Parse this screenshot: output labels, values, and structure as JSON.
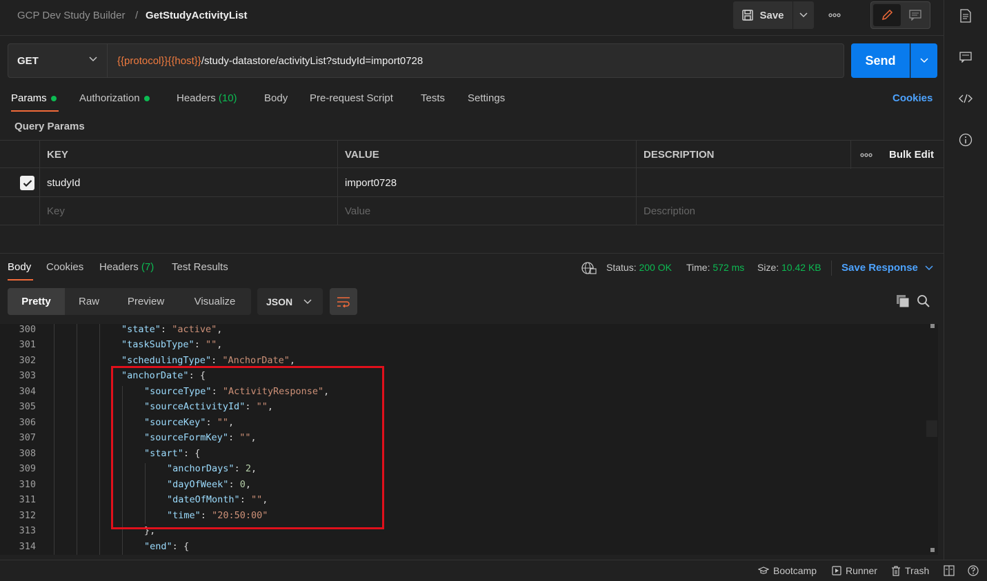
{
  "header": {
    "workspace": "GCP Dev Study Builder",
    "separator": "/",
    "request_name": "GetStudyActivityList",
    "save_label": "Save"
  },
  "request": {
    "method": "GET",
    "url_var1": "{{protocol}}",
    "url_var2": "{{host}}",
    "url_path": "/study-datastore/activityList?studyId=import0728",
    "send_label": "Send"
  },
  "request_tabs": [
    {
      "label": "Params"
    },
    {
      "label": "Authorization"
    },
    {
      "label": "Headers ",
      "count": "(10)"
    },
    {
      "label": "Body"
    },
    {
      "label": "Pre-request Script"
    },
    {
      "label": "Tests"
    },
    {
      "label": "Settings"
    }
  ],
  "cookies_label": "Cookies",
  "query_params": {
    "title": "Query Params",
    "headers": {
      "key": "KEY",
      "value": "VALUE",
      "description": "DESCRIPTION",
      "bulk_edit": "Bulk Edit"
    },
    "rows": [
      {
        "key": "studyId",
        "value": "import0728",
        "description": "",
        "checked": true
      }
    ],
    "placeholders": {
      "key": "Key",
      "value": "Value",
      "description": "Description"
    }
  },
  "response": {
    "tabs": [
      {
        "label": "Body"
      },
      {
        "label": "Cookies"
      },
      {
        "label": "Headers ",
        "count": "(7)"
      },
      {
        "label": "Test Results"
      }
    ],
    "status_label": "Status:",
    "status_value": "200 OK",
    "time_label": "Time:",
    "time_value": "572 ms",
    "size_label": "Size:",
    "size_value": "10.42 KB",
    "save_response": "Save Response",
    "formats": [
      "Pretty",
      "Raw",
      "Preview",
      "Visualize"
    ],
    "language": "JSON"
  },
  "code_lines": [
    {
      "n": "300",
      "indent": 5,
      "key": "state",
      "val": "\"active\"",
      "type": "str",
      "trail": ","
    },
    {
      "n": "301",
      "indent": 5,
      "key": "taskSubType",
      "val": "\"\"",
      "type": "str",
      "trail": ","
    },
    {
      "n": "302",
      "indent": 5,
      "key": "schedulingType",
      "val": "\"AnchorDate\"",
      "type": "str",
      "trail": ","
    },
    {
      "n": "303",
      "indent": 5,
      "key": "anchorDate",
      "val": "{",
      "type": "punc",
      "trail": ""
    },
    {
      "n": "304",
      "indent": 6,
      "key": "sourceType",
      "val": "\"ActivityResponse\"",
      "type": "str",
      "trail": ","
    },
    {
      "n": "305",
      "indent": 6,
      "key": "sourceActivityId",
      "val": "\"\"",
      "type": "str",
      "trail": ","
    },
    {
      "n": "306",
      "indent": 6,
      "key": "sourceKey",
      "val": "\"\"",
      "type": "str",
      "trail": ","
    },
    {
      "n": "307",
      "indent": 6,
      "key": "sourceFormKey",
      "val": "\"\"",
      "type": "str",
      "trail": ","
    },
    {
      "n": "308",
      "indent": 6,
      "key": "start",
      "val": "{",
      "type": "punc",
      "trail": ""
    },
    {
      "n": "309",
      "indent": 7,
      "key": "anchorDays",
      "val": "2",
      "type": "num",
      "trail": ","
    },
    {
      "n": "310",
      "indent": 7,
      "key": "dayOfWeek",
      "val": "0",
      "type": "num",
      "trail": ","
    },
    {
      "n": "311",
      "indent": 7,
      "key": "dateOfMonth",
      "val": "\"\"",
      "type": "str",
      "trail": ","
    },
    {
      "n": "312",
      "indent": 7,
      "key": "time",
      "val": "\"20:50:00\"",
      "type": "str",
      "trail": ""
    },
    {
      "n": "313",
      "indent": 6,
      "key": "",
      "val": "},",
      "type": "punc",
      "trail": ""
    },
    {
      "n": "314",
      "indent": 6,
      "key": "end",
      "val": "{",
      "type": "punc",
      "trail": ""
    }
  ],
  "footer": {
    "bootcamp": "Bootcamp",
    "runner": "Runner",
    "trash": "Trash"
  },
  "colors": {
    "accent_orange": "#f26b3a",
    "send_blue": "#097bed",
    "status_green": "#0cbb52",
    "highlight_red": "#e0101b"
  }
}
